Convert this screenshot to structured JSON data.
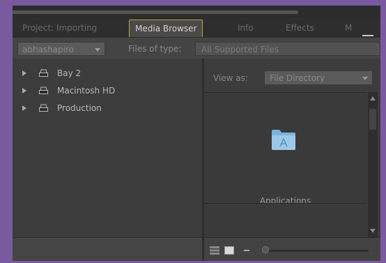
{
  "tabs": [
    {
      "label": "Project: Importing"
    },
    {
      "label": "Media Browser"
    },
    {
      "label": "Info"
    },
    {
      "label": "Effects"
    },
    {
      "label": "M"
    }
  ],
  "toolbar": {
    "user_select": "abhashapiro",
    "files_of_type_label": "Files of type:",
    "files_of_type_value": "All Supported Files"
  },
  "tree": {
    "items": [
      {
        "label": "Bay 2"
      },
      {
        "label": "Macintosh HD"
      },
      {
        "label": "Production"
      }
    ]
  },
  "view": {
    "view_as_label": "View as:",
    "view_as_value": "File Directory",
    "folder_label": "Applications"
  },
  "colors": {
    "frame": "#7a5a9e",
    "panel": "#3e3e3e",
    "active_tab_border": "#bca44a"
  }
}
